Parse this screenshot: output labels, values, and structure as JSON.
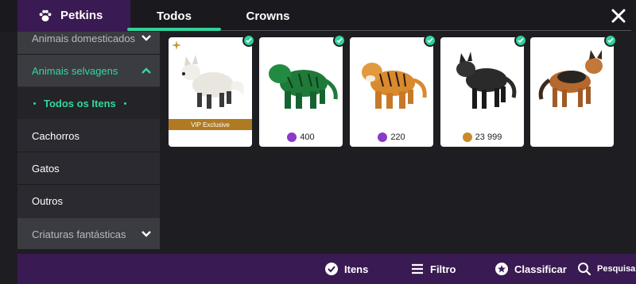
{
  "header": {
    "brand": "Petkins",
    "tabs": [
      "Todos",
      "Crowns"
    ]
  },
  "sidebar": {
    "categories": [
      {
        "label": "Animais domesticados",
        "state": "collapsed"
      },
      {
        "label": "Animais selvagens",
        "state": "expanded"
      },
      {
        "label": "Cachorros"
      },
      {
        "label": "Gatos"
      },
      {
        "label": "Outros"
      },
      {
        "label": "Criaturas fantásticas",
        "state": "collapsed"
      }
    ],
    "subitem": "Todos os Itens"
  },
  "items": [
    {
      "animal": "white-fox",
      "badge": "VIP Exclusive",
      "equipped": true
    },
    {
      "animal": "green-tiger",
      "currency": "gem-icon",
      "price": "400",
      "equipped": true
    },
    {
      "animal": "tiger",
      "currency": "gem-icon",
      "price": "220",
      "equipped": true
    },
    {
      "animal": "black-wolf",
      "currency": "coin-icon",
      "price": "23 999",
      "equipped": true
    },
    {
      "animal": "german-shepherd",
      "equipped": true
    }
  ],
  "footer": {
    "items_label": "Itens",
    "filter_label": "Filtro",
    "sort_label": "Classificar",
    "search_label": "Pesquisa"
  },
  "colors": {
    "accent": "#2fd19a",
    "brand_purple": "#3a1a52",
    "background": "#1e1e22",
    "vip_gold": "#b07a22"
  }
}
